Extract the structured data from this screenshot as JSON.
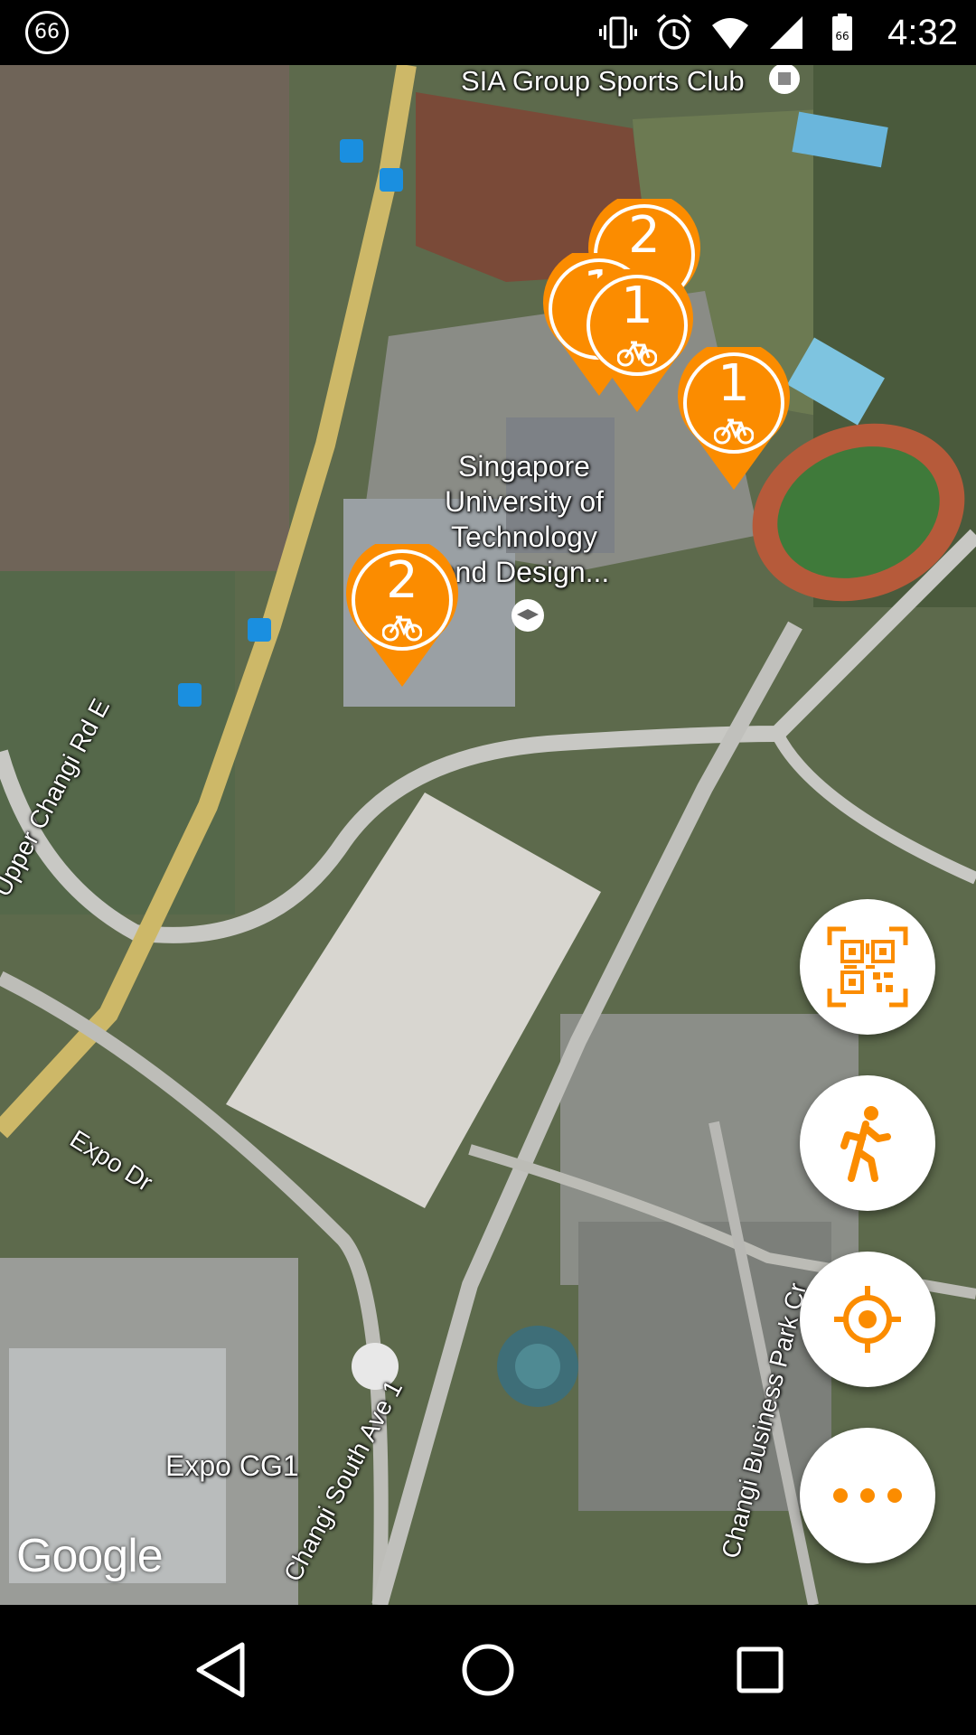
{
  "status_bar": {
    "badge": "66",
    "battery_level": "66",
    "time": "4:32",
    "icons": [
      "vibrate-icon",
      "alarm-icon",
      "wifi-icon",
      "cell-signal-icon",
      "battery-icon"
    ]
  },
  "map": {
    "place_labels": {
      "sia_club": "SIA Group Sports Club",
      "sutd": "Singapore University of Technology and Design...",
      "expo": "Expo CG1"
    },
    "road_labels": {
      "upper_changi": "Upper Changi Rd E",
      "expo_dr": "Expo Dr",
      "changi_south": "Changi South Ave 1",
      "changi_business": "Changi Business Park Cr"
    },
    "bike_pins": [
      {
        "count": "2"
      },
      {
        "count": "1"
      },
      {
        "count": "1"
      },
      {
        "count": "1"
      },
      {
        "count": "2"
      }
    ],
    "attribution": "Google"
  },
  "colors": {
    "accent": "#FB8C00",
    "white": "#FFFFFF"
  },
  "fabs": [
    "qr-scan-icon",
    "walking-person-icon",
    "my-location-icon",
    "more-icon"
  ],
  "nav_bar": [
    "back-icon",
    "home-icon",
    "recents-icon"
  ]
}
